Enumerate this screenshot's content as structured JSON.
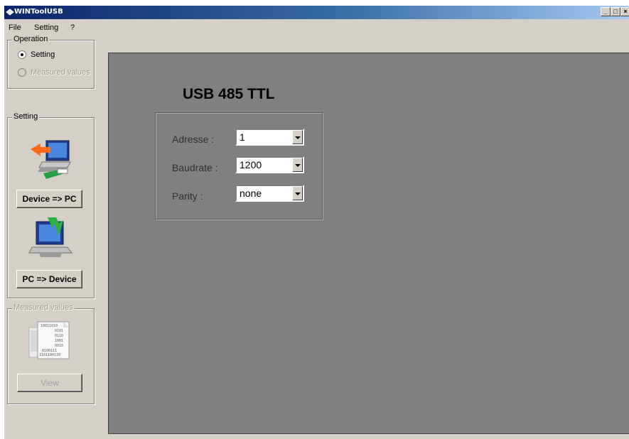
{
  "window": {
    "title": "WINToolUSB"
  },
  "menu": {
    "items": [
      "File",
      "Setting",
      "?"
    ]
  },
  "operation": {
    "legend": "Operation",
    "options": [
      {
        "label": "Setting",
        "checked": true,
        "enabled": true
      },
      {
        "label": "Measured values",
        "checked": false,
        "enabled": false
      }
    ]
  },
  "setting_group": {
    "legend": "Setting",
    "device_to_pc_label": "Device => PC",
    "pc_to_device_label": "PC => Device"
  },
  "measured_group": {
    "legend": "Measured values",
    "view_label": "View",
    "icon_digits": [
      "10011010",
      "0101",
      "0110",
      "1001",
      "0010",
      "0100111",
      "1101100110"
    ]
  },
  "main": {
    "title": "USB 485 TTL",
    "fields": [
      {
        "label": "Adresse :",
        "value": "1"
      },
      {
        "label": "Baudrate :",
        "value": "1200"
      },
      {
        "label": "Parity :",
        "value": "none"
      }
    ]
  }
}
